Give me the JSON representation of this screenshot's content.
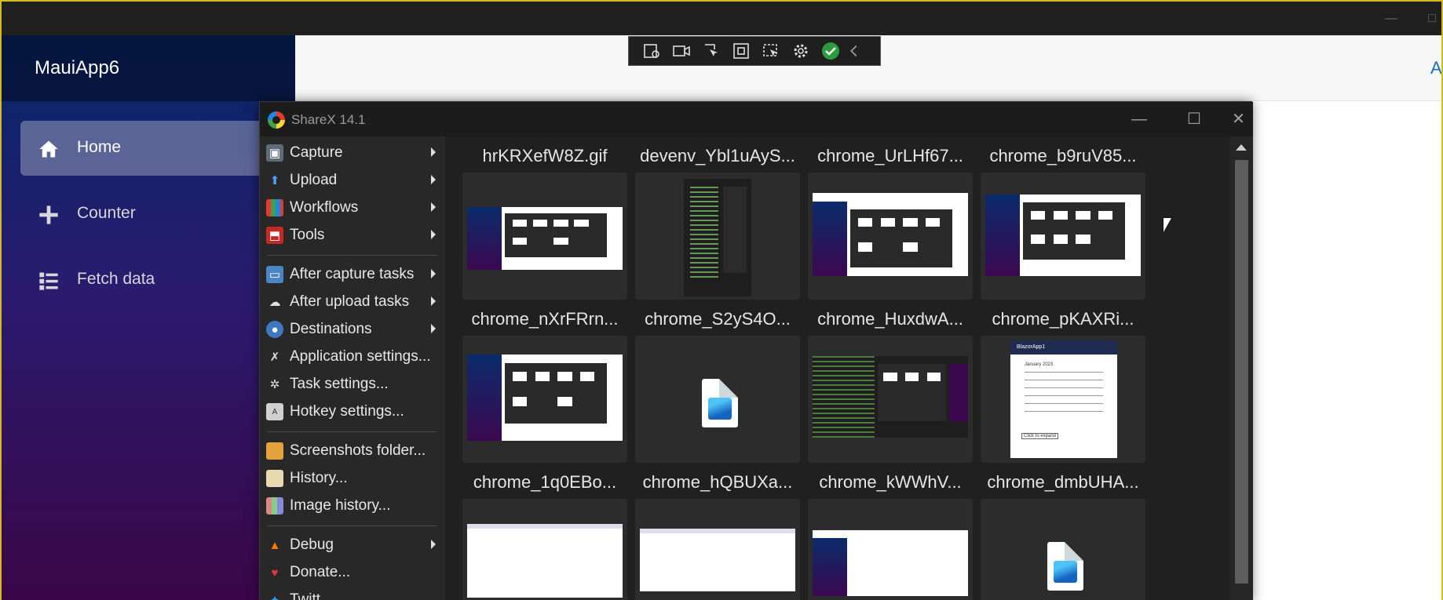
{
  "maui": {
    "brand": "MauiApp6",
    "about_link": "A",
    "nav": [
      {
        "label": "Home",
        "icon": "home-icon",
        "active": true
      },
      {
        "label": "Counter",
        "icon": "plus-icon",
        "active": false
      },
      {
        "label": "Fetch data",
        "icon": "list-icon",
        "active": false
      }
    ]
  },
  "sharex": {
    "title": "ShareX 14.1",
    "menu": [
      {
        "label": "Capture",
        "icon": "capture-icon",
        "submenu": true
      },
      {
        "label": "Upload",
        "icon": "upload-arrow-icon",
        "submenu": true
      },
      {
        "label": "Workflows",
        "icon": "workflows-icon",
        "submenu": true
      },
      {
        "label": "Tools",
        "icon": "toolbox-icon",
        "submenu": true
      },
      {
        "label": "After capture tasks",
        "icon": "after-capture-icon",
        "submenu": true
      },
      {
        "label": "After upload tasks",
        "icon": "cloud-upload-icon",
        "submenu": true
      },
      {
        "label": "Destinations",
        "icon": "destinations-icon",
        "submenu": true
      },
      {
        "label": "Application settings...",
        "icon": "wrench-icon",
        "submenu": false
      },
      {
        "label": "Task settings...",
        "icon": "gear-icon",
        "submenu": false
      },
      {
        "label": "Hotkey settings...",
        "icon": "keyboard-icon",
        "submenu": false
      },
      {
        "label": "Screenshots folder...",
        "icon": "folder-icon",
        "submenu": false
      },
      {
        "label": "History...",
        "icon": "history-icon",
        "submenu": false
      },
      {
        "label": "Image history...",
        "icon": "image-history-icon",
        "submenu": false
      },
      {
        "label": "Debug",
        "icon": "traffic-cone-icon",
        "submenu": true
      },
      {
        "label": "Donate...",
        "icon": "heart-icon",
        "submenu": false
      },
      {
        "label": "Twitt",
        "icon": "twitter-icon",
        "submenu": false
      }
    ],
    "thumbnails": [
      {
        "name": "hrKRXefW8Z.gif",
        "kind": "screenshot"
      },
      {
        "name": "devenv_Ybl1uAyS...",
        "kind": "code"
      },
      {
        "name": "chrome_UrLHf67...",
        "kind": "screenshot"
      },
      {
        "name": "chrome_b9ruV85...",
        "kind": "screenshot"
      },
      {
        "name": "chrome_nXrFRrn...",
        "kind": "screenshot"
      },
      {
        "name": "chrome_S2yS4O...",
        "kind": "file"
      },
      {
        "name": "chrome_HuxdwA...",
        "kind": "screenshot"
      },
      {
        "name": "chrome_pKAXRi...",
        "kind": "calendar"
      },
      {
        "name": "chrome_1q0EBo...",
        "kind": "blank"
      },
      {
        "name": "chrome_hQBUXa...",
        "kind": "blank"
      },
      {
        "name": "chrome_kWWhV...",
        "kind": "screenshot"
      },
      {
        "name": "chrome_dmbUHA...",
        "kind": "file"
      }
    ],
    "calendar_thumb": {
      "app": "BlazorApp1",
      "month": "January 2023",
      "button": "Click to expand"
    }
  },
  "toolbar": {
    "tools": [
      "capture-settings-icon",
      "screen-record-icon",
      "select-region-icon",
      "fullscreen-icon",
      "auto-capture-icon",
      "settings-gear-icon",
      "confirm-check-icon",
      "collapse-chevron-icon"
    ]
  },
  "colors": {
    "accent": "#1b6ec2",
    "window_border": "#d4b920",
    "sharex_bg": "#202020"
  }
}
